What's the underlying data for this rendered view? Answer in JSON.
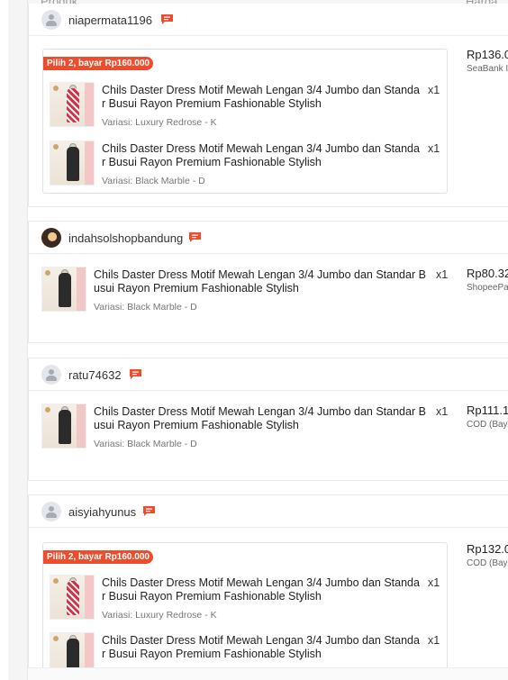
{
  "columns": {
    "product": "Produk",
    "price": "Harga To"
  },
  "orders": [
    {
      "username": "niapermata1196",
      "avatar": "default-avatar",
      "price": "Rp136.0",
      "payment": "SeaBank I",
      "promo": "Pilih 2, bayar Rp160.000",
      "items": [
        {
          "title_line1": "Chils Daster Dress Motif Mewah Lengan 3/4 Jumbo dan Standa",
          "title_line2": "r Busui Rayon Premium Fashionable Stylish",
          "qty": "x1",
          "variant": "Variasi: Luxury Redrose - K"
        },
        {
          "title_line1": "Chils Daster Dress Motif Mewah Lengan 3/4 Jumbo dan Standa",
          "title_line2": "r Busui Rayon Premium Fashionable Stylish",
          "qty": "x1",
          "variant": "Variasi: Black Marble - D"
        }
      ]
    },
    {
      "username": "indahsolshopbandung",
      "avatar": "photo-avatar",
      "price": "Rp80.32",
      "payment": "ShopeePa",
      "items": [
        {
          "title_line1": "Chils Daster Dress Motif Mewah Lengan 3/4 Jumbo dan Standar B",
          "title_line2": "usui Rayon Premium Fashionable Stylish",
          "qty": "x1",
          "variant": "Variasi: Black Marble - D"
        }
      ]
    },
    {
      "username": "ratu74632",
      "avatar": "default-avatar",
      "price": "Rp111.1",
      "payment": "COD (Bay",
      "items": [
        {
          "title_line1": "Chils Daster Dress Motif Mewah Lengan 3/4 Jumbo dan Standar B",
          "title_line2": "usui Rayon Premium Fashionable Stylish",
          "qty": "x1",
          "variant": "Variasi: Black Marble - D"
        }
      ]
    },
    {
      "username": "aisyiahyunus",
      "avatar": "default-avatar",
      "price": "Rp132.0",
      "payment": "COD (Bay",
      "promo": "Pilih 2, bayar Rp160.000",
      "items": [
        {
          "title_line1": "Chils Daster Dress Motif Mewah Lengan 3/4 Jumbo dan Standa",
          "title_line2": "r Busui Rayon Premium Fashionable Stylish",
          "qty": "x1",
          "variant": "Variasi: Luxury Redrose - K"
        },
        {
          "title_line1": "Chils Daster Dress Motif Mewah Lengan 3/4 Jumbo dan Standa",
          "title_line2": "r Busui Rayon Premium Fashionable Stylish",
          "qty": "x1",
          "variant": ""
        }
      ]
    }
  ],
  "colors": {
    "accent": "#ee4d2d",
    "text": "#222222",
    "muted": "#777777"
  },
  "icons": {
    "chat": "chat-bubble-icon",
    "avatar": "user-avatar-icon"
  }
}
